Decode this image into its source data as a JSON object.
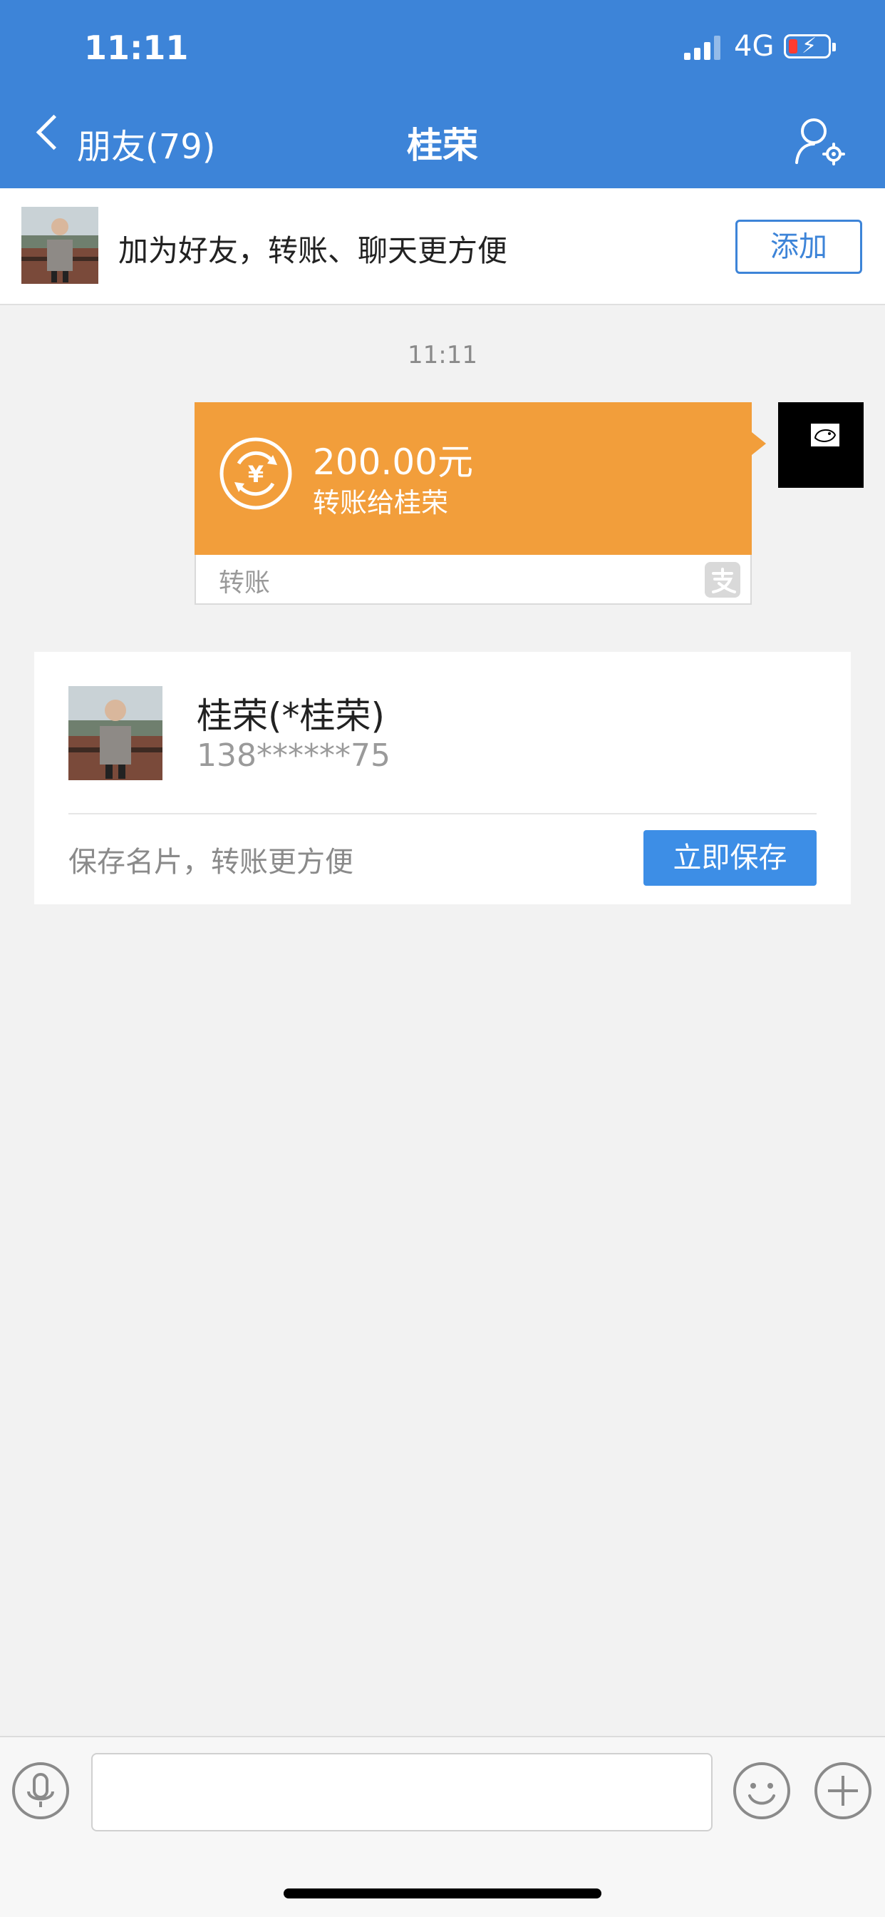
{
  "status_bar": {
    "time": "11:11",
    "network": "4G"
  },
  "nav": {
    "back_label": "朋友(79)",
    "title": "桂荣"
  },
  "add_friend_bar": {
    "text": "加为好友，转账、聊天更方便",
    "button_label": "添加"
  },
  "chat": {
    "timestamp": "11:11",
    "transfer": {
      "amount": "200.00元",
      "description": "转账给桂荣",
      "type_label": "转账"
    }
  },
  "contact_card": {
    "name": "桂荣(*桂荣)",
    "phone": "138******75",
    "hint": "保存名片，转账更方便",
    "save_button_label": "立即保存"
  },
  "input_bar": {
    "placeholder": ""
  },
  "colors": {
    "header_blue": "#3d84d8",
    "transfer_orange": "#f29e3b",
    "save_blue": "#3d8ee6",
    "background": "#f2f2f2"
  }
}
